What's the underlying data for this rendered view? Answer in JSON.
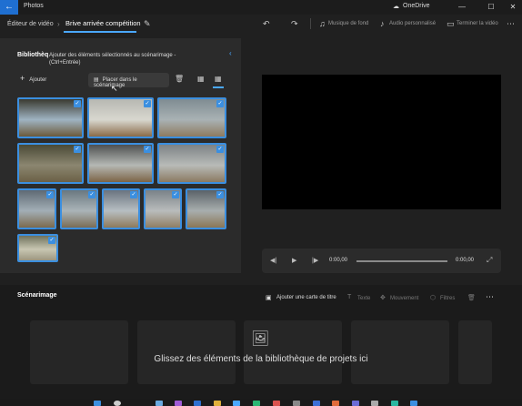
{
  "window": {
    "app_title": "Photos",
    "onedrive_label": "OneDrive"
  },
  "toolbar": {
    "crumb_editor": "Éditeur de vidéo",
    "crumb_project": "Brive arrivée compétition",
    "music_label": "Musique de fond",
    "audio_label": "Audio personnalisé",
    "finish_label": "Terminer la vidéo"
  },
  "library": {
    "title": "Bibliothèq",
    "hint": "Ajouter des éléments sélectionnés au scénarimage - (Ctrl+Entrée)",
    "add_label": "Ajouter",
    "place_label": "Placer dans le scénarimage",
    "thumbnails": [
      {
        "colors": [
          "#3a3a30",
          "#9fb3c2",
          "#6b5a3a"
        ]
      },
      {
        "colors": [
          "#b7b8b2",
          "#d8d7cf",
          "#8a6b48"
        ]
      },
      {
        "colors": [
          "#7f8c92",
          "#a9b2b4",
          "#8e7a60"
        ]
      },
      {
        "colors": [
          "#4a4a36",
          "#8b8670",
          "#6b6046"
        ]
      },
      {
        "colors": [
          "#4e5050",
          "#b5b8b4",
          "#7c6446"
        ]
      },
      {
        "colors": [
          "#7d8285",
          "#b8bbb8",
          "#8b7a62"
        ]
      },
      {
        "colors": [
          "#5f6a74",
          "#a2aeb6",
          "#7b6a4e"
        ]
      },
      {
        "colors": [
          "#6a7880",
          "#aab4b8",
          "#7a6c56"
        ]
      },
      {
        "colors": [
          "#6a7480",
          "#b7bec2",
          "#8d7a5c"
        ]
      },
      {
        "colors": [
          "#7a8288",
          "#b9bcbc",
          "#8f7e64"
        ]
      },
      {
        "colors": [
          "#5a6268",
          "#a8aeae",
          "#8a7656"
        ]
      },
      {
        "colors": [
          "#6f725c",
          "#c8c6b2",
          "#9c9680"
        ]
      }
    ]
  },
  "player": {
    "time_start": "0:00,00",
    "time_end": "0:00,00"
  },
  "storyboard": {
    "title": "Scénarimage",
    "add_card_label": "Ajouter une carte de titre",
    "text_label": "Texte",
    "motion_label": "Mouvement",
    "filters_label": "Filtres",
    "drop_text": "Glissez des éléments de la bibliothèque de projets ici"
  },
  "accent_color": "#3b8fe0"
}
